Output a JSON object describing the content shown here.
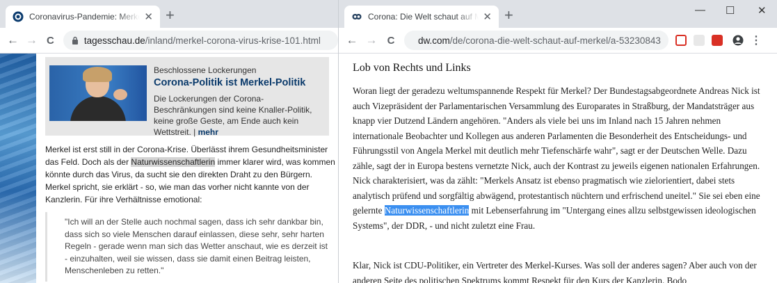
{
  "left_window": {
    "tab": {
      "title": "Coronavirus-Pandemie: Merkel, d",
      "close": "✕"
    },
    "new_tab": "+",
    "toolbar": {
      "back": "←",
      "forward": "→",
      "reload": "C",
      "lock": "🔒",
      "url_domain": "tagesschau.de",
      "url_path": "/inland/merkel-corona-virus-krise-101.html"
    },
    "teaser": {
      "kicker": "Beschlossene Lockerungen",
      "headline": "Corona-Politik ist Merkel-Politik",
      "text": "Die Lockerungen der Corona-Beschränkungen sind keine Knaller-Politik, keine große Geste, am Ende auch kein Wettstreit. | ",
      "more": "mehr"
    },
    "body_part1": "Merkel ist erst still in der Corona-Krise. Überlässt ihrem Gesundheitsminister das Feld. Doch als der ",
    "body_highlight": "Naturwissenschaftlerin",
    "body_part2": " immer klarer wird, was kommen könnte durch das Virus, da sucht sie den direkten Draht zu den Bürgern. Merkel spricht, sie erklärt - so, wie man das vorher nicht kannte von der Kanzlerin. Für ihre Verhältnisse emotional:",
    "quote": "\"Ich will an der Stelle auch nochmal sagen, dass ich sehr dankbar bin, dass sich so viele Menschen darauf einlassen, diese sehr, sehr harten Regeln - gerade wenn man sich das Wetter anschaut, wie es derzeit ist - einzuhalten, weil sie wissen, dass sie damit einen Beitrag leisten, Menschenleben zu retten.\""
  },
  "right_window": {
    "tab": {
      "title": "Corona: Die Welt schaut auf Merk",
      "close": "✕"
    },
    "new_tab": "+",
    "window_controls": {
      "minimize": "—",
      "maximize": "☐",
      "close": "✕"
    },
    "toolbar": {
      "back": "←",
      "forward": "→",
      "reload": "C",
      "lock": "🔒",
      "url_domain": "dw.com",
      "url_path": "/de/corona-die-welt-schaut-auf-merkel/a-53230843",
      "star": "☆",
      "menu": "⋮"
    },
    "heading": "Lob von Rechts und Links",
    "para1_a": "Woran liegt der geradezu weltumspannende Respekt für Merkel? Der Bundestagsabgeordnete Andreas Nick ist auch Vizepräsident der Parlamentarischen Versammlung des Europarates in Straßburg, der Mandatsträger aus knapp vier Dutzend Ländern angehören. \"Anders als viele bei uns im Inland nach 15 Jahren nehmen internationale Beobachter und Kollegen aus anderen Parlamenten die Besonderheit des Entscheidungs- und Führungsstil von Angela Merkel mit deutlich mehr Tiefenschärfe wahr\", sagt er der Deutschen Welle. Dazu zähle, sagt der in Europa bestens vernetzte Nick, auch der Kontrast zu jeweils eigenen nationalen Erfahrungen. Nick charakterisiert, was da zählt: \"Merkels Ansatz ist ebenso pragmatisch wie zielorientiert, dabei stets analytisch prüfend und sorgfältig abwägend, protestantisch nüchtern und erfrischend uneitel.\" Sie sei eben eine gelernte ",
    "para1_sel": "Naturwissenschaftlerin",
    "para1_b": " mit Lebenserfahrung im \"Untergang eines allzu selbstgewissen ideologischen Systems\", der DDR, - und nicht zuletzt eine Frau.",
    "para2": "Klar, Nick ist CDU-Politiker, ein Vertreter des Merkel-Kurses. Was soll der anderes sagen? Aber auch von der anderen Seite des politischen Spektrums kommt Respekt für den Kurs der Kanzlerin. Bodo"
  }
}
